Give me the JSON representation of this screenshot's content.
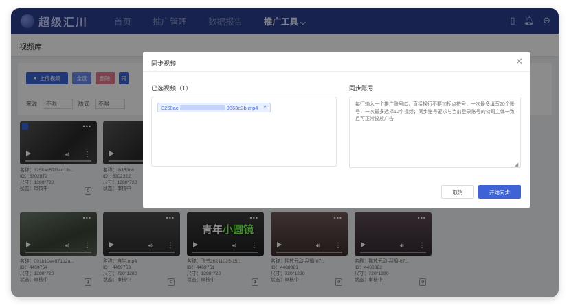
{
  "app": {
    "logo_text": "超级汇川",
    "nav": [
      {
        "label": "首页"
      },
      {
        "label": "推广管理"
      },
      {
        "label": "数据报告"
      },
      {
        "label": "推广工具",
        "chevron": "chevron-down-icon"
      }
    ],
    "top_icons": [
      "phone-icon",
      "bell-icon",
      "user-circle-icon"
    ]
  },
  "page": {
    "breadcrumb": "视频库"
  },
  "toolbar": {
    "upload_label": "上传视频",
    "select_all_label": "全选",
    "delete_label": "删除",
    "sync_label": "同",
    "filter_source_label": "来源",
    "filter_source_value": "不限",
    "filter_style_label": "版式",
    "filter_style_value": "不限"
  },
  "cards": [
    {
      "name": "名称：3250ac57f3ad1fb...",
      "id": "ID：5302872",
      "size": "尺寸：1280*720",
      "status": "状态：审核中",
      "count": "0",
      "checked": true
    },
    {
      "name": "名称：fb353b8",
      "id": "ID：5302322",
      "size": "尺寸：1280*720",
      "status": "状态：审核中",
      "count": "",
      "checked": false
    },
    {
      "name": "名称：091b10e4071d2a...",
      "id": "ID：4469754",
      "size": "尺寸：1280*720",
      "status": "状态：审核中",
      "count": "1",
      "checked": false
    },
    {
      "name": "名称：自牛.mp4",
      "id": "ID：4469753",
      "size": "尺寸：720*1280",
      "status": "状态：审核中",
      "count": "0",
      "checked": false
    },
    {
      "name": "名称：飞书20211025-15...",
      "id": "ID：4469751",
      "size": "尺寸：1280*720",
      "status": "状态：审核中",
      "count": "1",
      "checked": false,
      "overlay_line1": "青年",
      "overlay_hl": "小圆镜"
    },
    {
      "name": "名称：摇放元动-刮播-07...",
      "id": "ID：4468881",
      "size": "尺寸：720*1280",
      "status": "状态：审核中",
      "count": "0",
      "checked": false
    },
    {
      "name": "名称：摇放元动-刮播-07...",
      "id": "ID：4468882",
      "size": "尺寸：720*1280",
      "status": "状态：审核中",
      "count": "0",
      "checked": false
    }
  ],
  "modal": {
    "title": "同步视频",
    "selected_label": "已选视频（1）",
    "selected_file_prefix": "3250ac",
    "selected_file_suffix": "0863e3b.mp4",
    "account_label": "同步账号",
    "account_placeholder": "每行输入一个推广账号ID，直接换行不要加标点符号，一次最多填写20个账号，一次最多选择10个视频；同步账号要求与当前登录账号的公司主体一致且可正常投放广告",
    "cancel_label": "取消",
    "start_label": "开始同步"
  }
}
